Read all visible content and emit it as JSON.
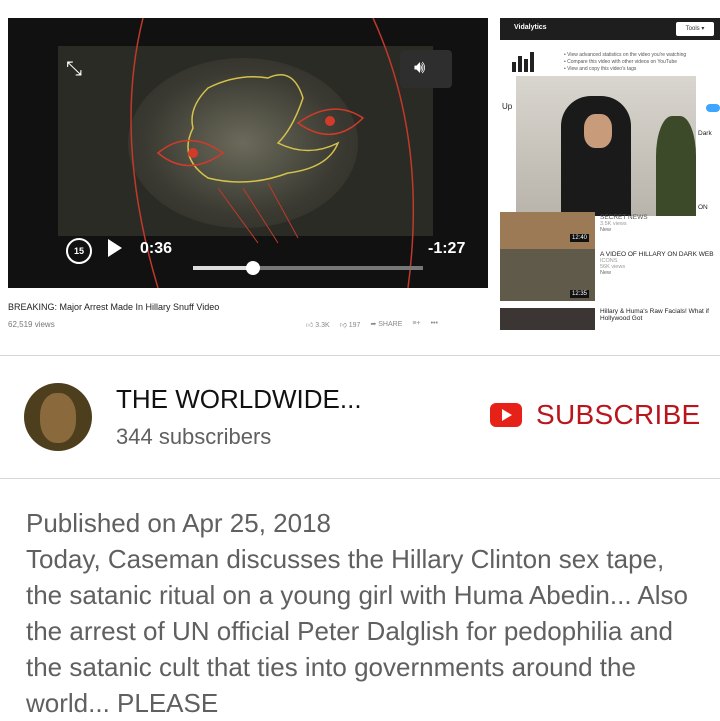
{
  "screenshot": {
    "player": {
      "rewind_label": "15",
      "current_time": "0:36",
      "remaining_time": "-1:27",
      "progress_fraction": 0.26
    },
    "video": {
      "title": "BREAKING: Major Arrest Made In Hillary Snuff Video",
      "views": "62,519 views",
      "likes": "3.3K",
      "dislikes": "197",
      "share_label": "SHARE"
    },
    "sidebar": {
      "extension_name": "Vidalytics",
      "tools_label": "Tools",
      "bullets": [
        "View advanced statistics on the video you're watching",
        "Compare this video with other videos on YouTube",
        "View and copy this video's tags"
      ],
      "up_next": "Up",
      "dark_label": "Dark",
      "on_label": "ON",
      "items": [
        {
          "title": "SECRET NEWS",
          "meta": "3.5K views",
          "badge": "New",
          "duration": "12:40"
        },
        {
          "title": "A VIDEO OF HILLARY ON DARK WEB",
          "meta": "ICONS",
          "views": "56K views",
          "badge": "New",
          "duration": "12:35"
        },
        {
          "title": "Hillary & Huma's Raw Facials! What if Hollywood Got"
        }
      ]
    }
  },
  "channel": {
    "name": "THE WORLDWIDE...",
    "subscribers": "344 subscribers",
    "subscribe_label": "SUBSCRIBE"
  },
  "description": {
    "published": "Published on Apr 25, 2018",
    "text": "Today, Caseman discusses the Hillary Clinton sex tape, the satanic ritual on a young girl with Huma Abedin... Also the arrest of UN official Peter Dalglish for pedophilia and the satanic cult that ties into governments around the world... PLEASE"
  },
  "colors": {
    "subscribe_red": "#b9151c",
    "youtube_red": "#e62117",
    "secondary_text": "#606060"
  }
}
